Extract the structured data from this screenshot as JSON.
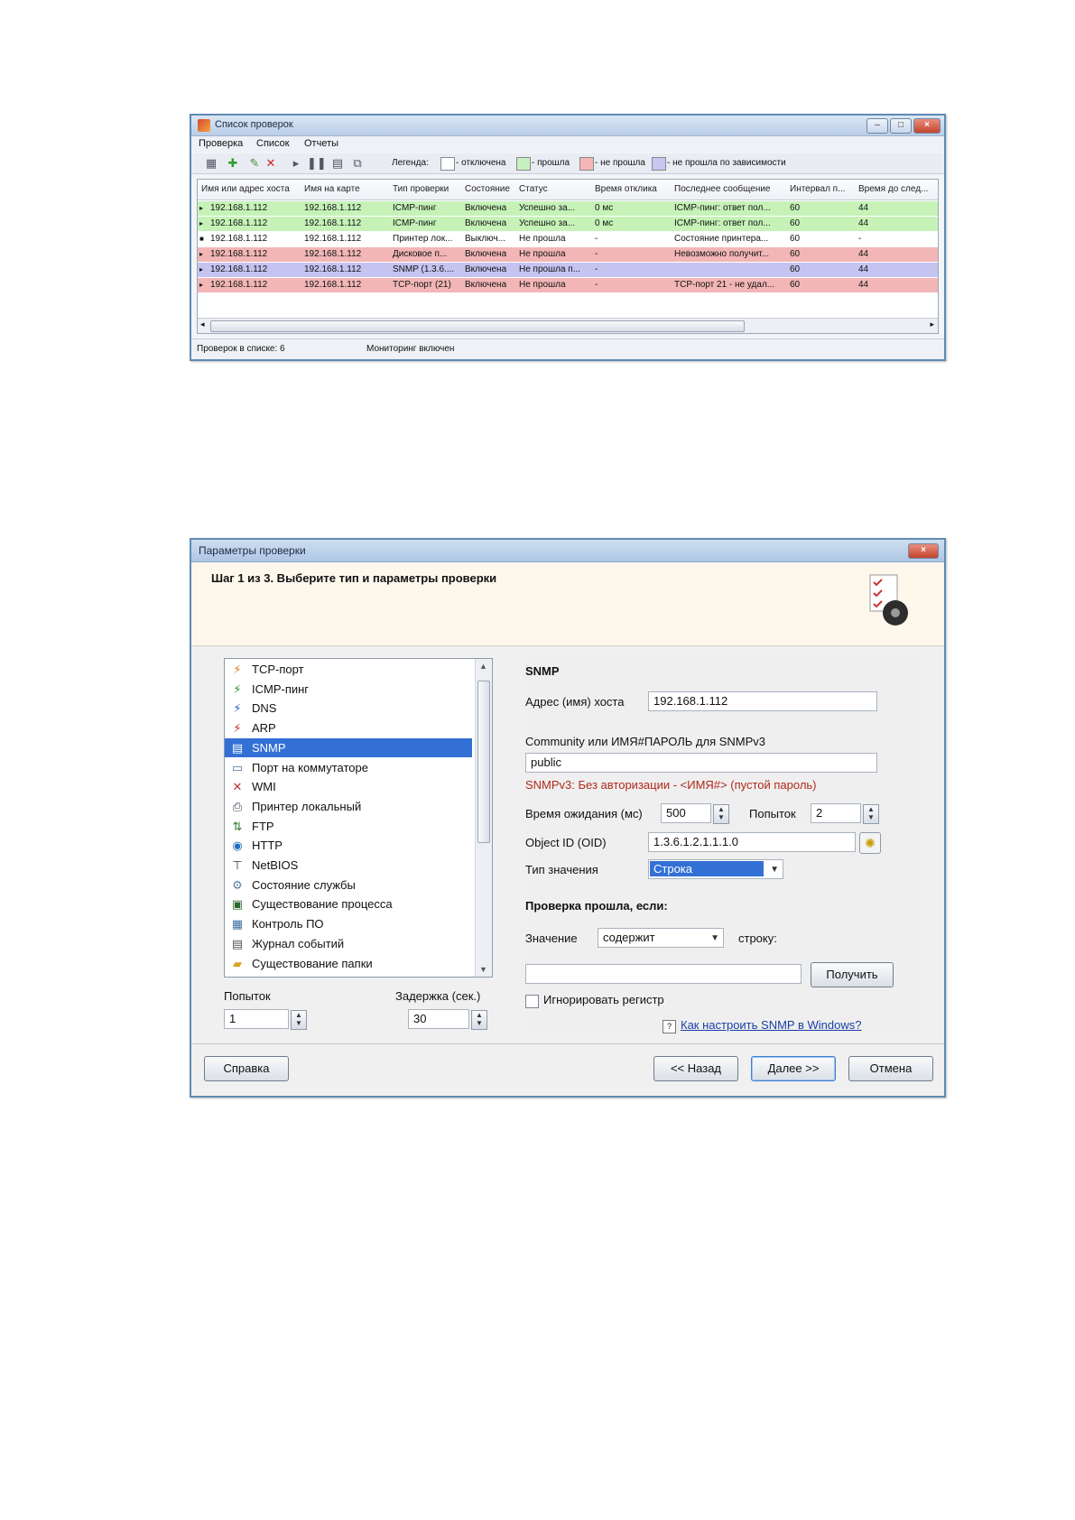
{
  "checks_window": {
    "title": "Список проверок",
    "menu": [
      "Проверка",
      "Список",
      "Отчеты"
    ],
    "legend_label": "Легенда:",
    "legend": [
      {
        "label": "- отключена",
        "color": "#ffffff"
      },
      {
        "label": "- прошла",
        "color": "#c8f0c0"
      },
      {
        "label": "- не прошла",
        "color": "#f4b6b6"
      },
      {
        "label": "- не прошла по зависимости",
        "color": "#c8c6f2"
      }
    ],
    "columns": [
      "Имя или адрес хоста",
      "Имя на карте",
      "Тип проверки",
      "Состояние",
      "Статус",
      "Время отклика",
      "Последнее сообщение",
      "Интервал п...",
      "Время до след..."
    ],
    "rows": [
      {
        "bg": "#c6f2b8",
        "cells": [
          "192.168.1.112",
          "192.168.1.112",
          "ICMP-пинг",
          "Включена",
          "Успешно за...",
          "0 мс",
          "ICMP-пинг: ответ пол...",
          "60",
          "44"
        ]
      },
      {
        "bg": "#c6f2b8",
        "cells": [
          "192.168.1.112",
          "192.168.1.112",
          "ICMP-пинг",
          "Включена",
          "Успешно за...",
          "0 мс",
          "ICMP-пинг: ответ пол...",
          "60",
          "44"
        ]
      },
      {
        "bg": "#ffffff",
        "cells": [
          "192.168.1.112",
          "192.168.1.112",
          "Принтер лок...",
          "Выключ...",
          "Не прошла",
          "-",
          "Состояние принтера...",
          "60",
          "-"
        ]
      },
      {
        "bg": "#f2b6b6",
        "cells": [
          "192.168.1.112",
          "192.168.1.112",
          "Дисковое п...",
          "Включена",
          "Не прошла",
          "-",
          "Невозможно получит...",
          "60",
          "44"
        ]
      },
      {
        "bg": "#c5c3f0",
        "cells": [
          "192.168.1.112",
          "192.168.1.112",
          "SNMP (1.3.6....",
          "Включена",
          "Не прошла п...",
          "-",
          "",
          "60",
          "44"
        ]
      },
      {
        "bg": "#f2b6b6",
        "cells": [
          "192.168.1.112",
          "192.168.1.112",
          "TCP-порт (21)",
          "Включена",
          "Не прошла",
          "-",
          "TCP-порт 21 - не удал...",
          "60",
          "44"
        ]
      }
    ],
    "status_count": "Проверок в списке: 6",
    "status_monitoring": "Мониторинг включен"
  },
  "params_window": {
    "title": "Параметры проверки",
    "step_title": "Шаг 1 из 3. Выберите тип и параметры проверки",
    "types": [
      {
        "label": "TCP-порт",
        "icon": "tcp-port-icon",
        "glyph": "⚡",
        "color": "#e07a1f"
      },
      {
        "label": "ICMP-пинг",
        "icon": "icmp-ping-icon",
        "glyph": "⚡",
        "color": "#2d8b2d"
      },
      {
        "label": "DNS",
        "icon": "dns-icon",
        "glyph": "⚡",
        "color": "#2a5fbf"
      },
      {
        "label": "ARP",
        "icon": "arp-icon",
        "glyph": "⚡",
        "color": "#c22a2a"
      },
      {
        "label": "SNMP",
        "icon": "snmp-icon",
        "glyph": "▤",
        "color": "#2a4f8f"
      },
      {
        "label": "Порт на коммутаторе",
        "icon": "switch-port-icon",
        "glyph": "▭",
        "color": "#4a6fa8"
      },
      {
        "label": "WMI",
        "icon": "wmi-icon",
        "glyph": "✕",
        "color": "#b33"
      },
      {
        "label": "Принтер локальный",
        "icon": "printer-icon",
        "glyph": "⎙",
        "color": "#445"
      },
      {
        "label": "FTP",
        "icon": "ftp-icon",
        "glyph": "⇅",
        "color": "#2f7a2f"
      },
      {
        "label": "HTTP",
        "icon": "http-globe-icon",
        "glyph": "◉",
        "color": "#1f6fbf"
      },
      {
        "label": "NetBIOS",
        "icon": "netbios-icon",
        "glyph": "⊤",
        "color": "#333"
      },
      {
        "label": "Состояние службы",
        "icon": "service-icon",
        "glyph": "⚙",
        "color": "#5a7fa8"
      },
      {
        "label": "Существование процесса",
        "icon": "process-icon",
        "glyph": "▣",
        "color": "#2d6a2d"
      },
      {
        "label": "Контроль ПО",
        "icon": "software-icon",
        "glyph": "▦",
        "color": "#3f6fa0"
      },
      {
        "label": "Журнал событий",
        "icon": "event-log-icon",
        "glyph": "▤",
        "color": "#555"
      },
      {
        "label": "Существование папки",
        "icon": "folder-icon",
        "glyph": "▰",
        "color": "#d9a520"
      }
    ],
    "selected_index": 4,
    "attempts_label": "Попыток",
    "attempts_value": "1",
    "delay_label": "Задержка (сек.)",
    "delay_value": "30",
    "snmp": {
      "heading": "SNMP",
      "host_label": "Адрес (имя) хоста",
      "host_value": "192.168.1.112",
      "community_label": "Community или ИМЯ#ПАРОЛЬ для SNMPv3",
      "community_value": "public",
      "hint": "SNMPv3: Без авторизации - <ИМЯ#> (пустой пароль)",
      "timeout_label": "Время ожидания (мс)",
      "timeout_value": "500",
      "retries_label": "Попыток",
      "retries_value": "2",
      "oid_label": "Object ID (OID)",
      "oid_value": "1.3.6.1.2.1.1.1.0",
      "value_type_label": "Тип значения",
      "value_type_selected": "Строка",
      "pass_heading": "Проверка прошла, если:",
      "value_label": "Значение",
      "condition_selected": "содержит",
      "string_label": "строку:",
      "string_value": "",
      "get_button": "Получить",
      "ignore_case_label": "Игнорировать регистр",
      "help_link": "Как настроить SNMP в Windows?"
    },
    "buttons": {
      "help": "Справка",
      "back": "<< Назад",
      "next": "Далее >>",
      "cancel": "Отмена"
    }
  }
}
